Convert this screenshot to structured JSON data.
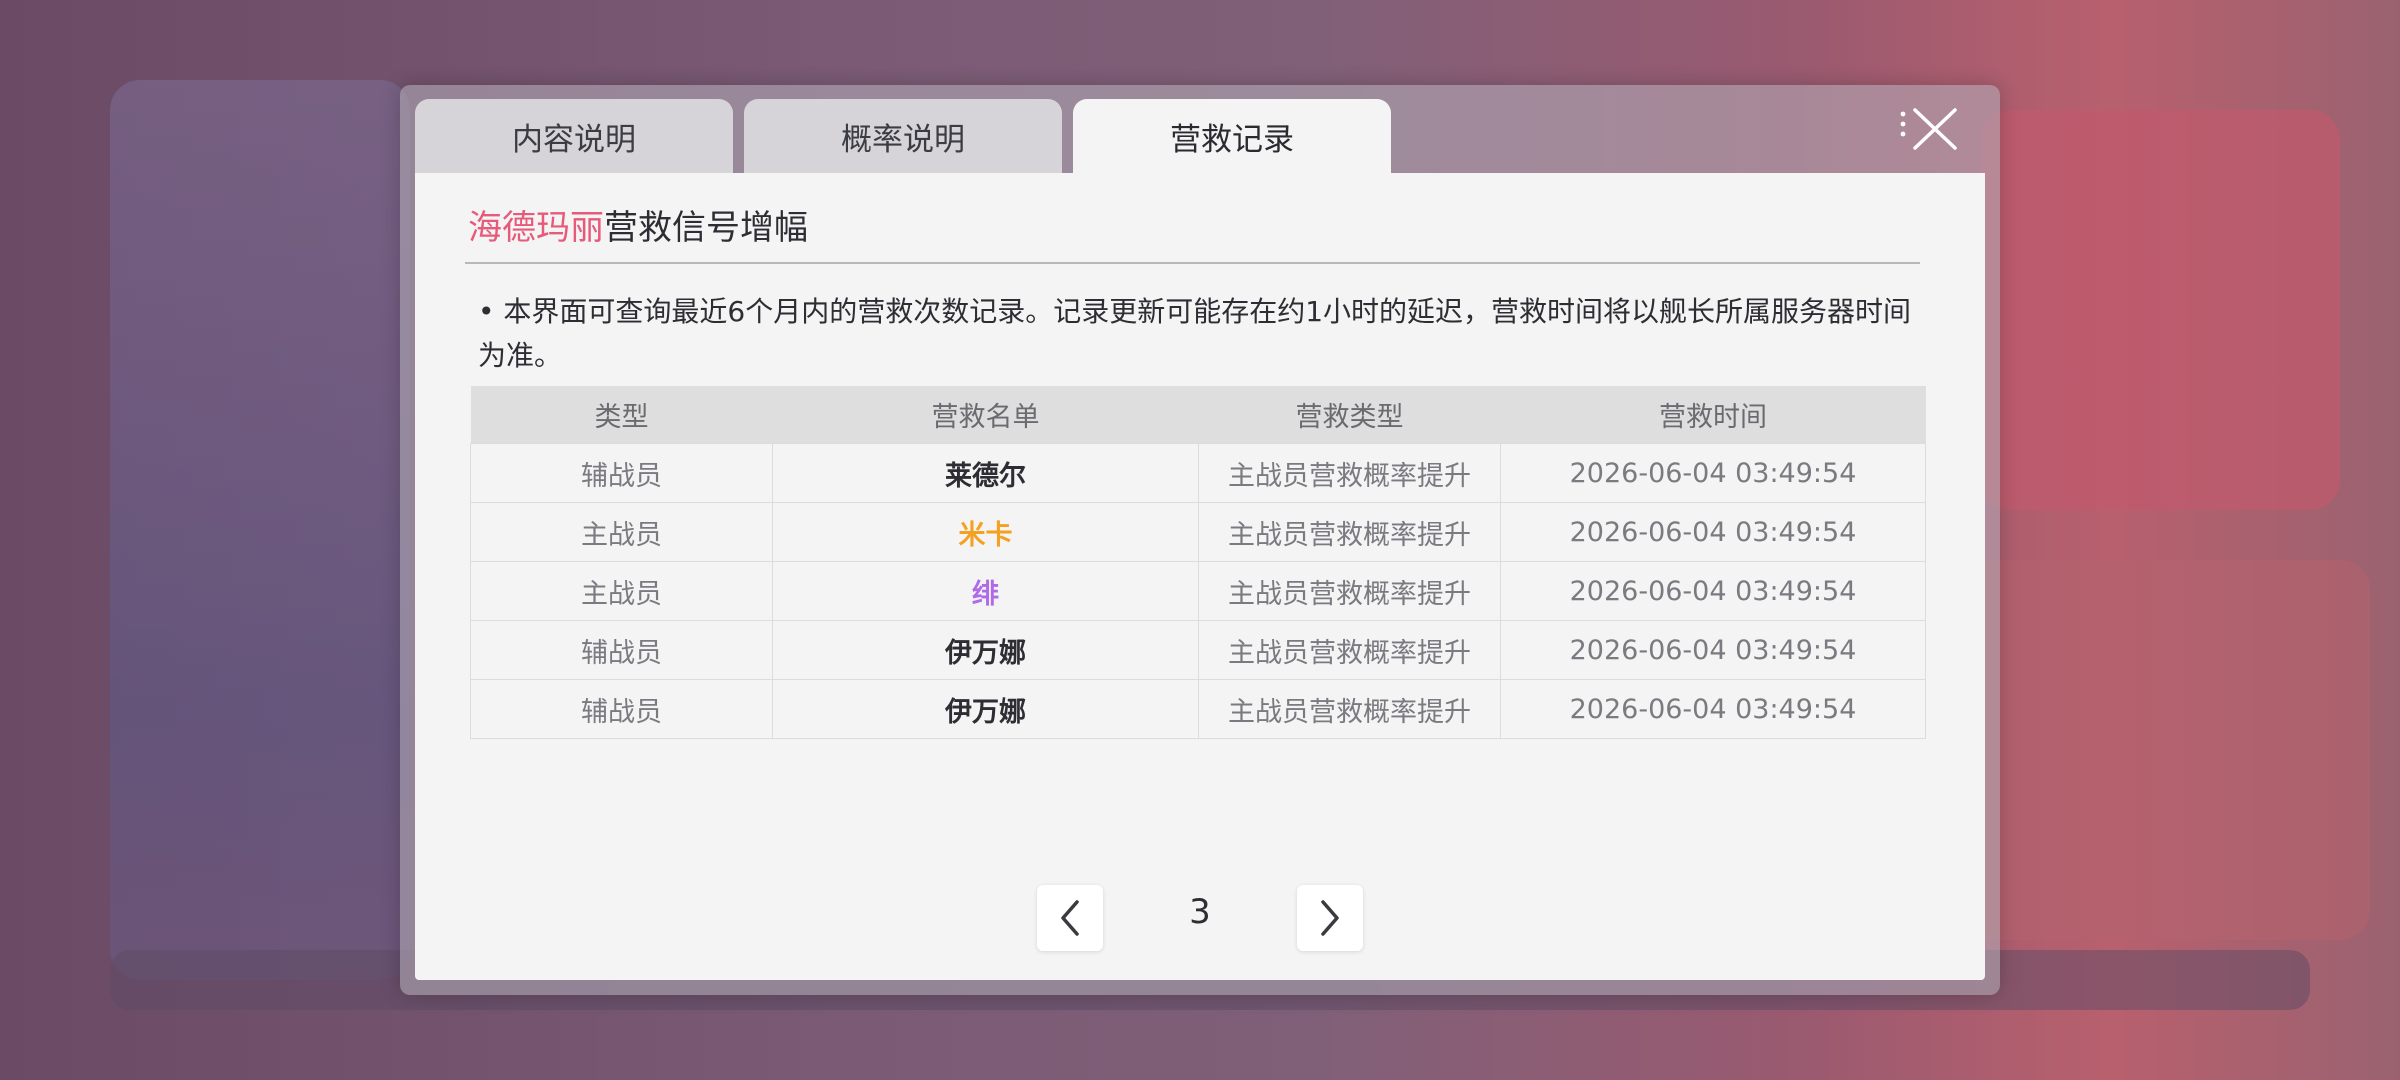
{
  "tabs": [
    {
      "label": "内容说明",
      "active": false
    },
    {
      "label": "概率说明",
      "active": false
    },
    {
      "label": "营救记录",
      "active": true
    }
  ],
  "title": {
    "highlight": "海德玛丽",
    "rest": "营救信号增幅"
  },
  "note": "• 本界面可查询最近6个月内的营救次数记录。记录更新可能存在约1小时的延迟，营救时间将以舰长所属服务器时间为准。",
  "table": {
    "headers": [
      "类型",
      "营救名单",
      "营救类型",
      "营救时间"
    ],
    "rows": [
      {
        "type": "辅战员",
        "name": "莱德尔",
        "rescue_type": "主战员营救概率提升",
        "time": "2026-06-04 03:49:54",
        "name_color": "default"
      },
      {
        "type": "主战员",
        "name": "米卡",
        "rescue_type": "主战员营救概率提升",
        "time": "2026-06-04 03:49:54",
        "name_color": "orange"
      },
      {
        "type": "主战员",
        "name": "绯",
        "rescue_type": "主战员营救概率提升",
        "time": "2026-06-04 03:49:54",
        "name_color": "purple"
      },
      {
        "type": "辅战员",
        "name": "伊万娜",
        "rescue_type": "主战员营救概率提升",
        "time": "2026-06-04 03:49:54",
        "name_color": "default"
      },
      {
        "type": "辅战员",
        "name": "伊万娜",
        "rescue_type": "主战员营救概率提升",
        "time": "2026-06-04 03:49:54",
        "name_color": "default"
      }
    ]
  },
  "pager": {
    "current_page": "3"
  },
  "colors": {
    "highlight": "#e65a7a",
    "orange": "#f4a020",
    "purple": "#b06ae8"
  },
  "icons": {
    "close": "close-icon",
    "prev": "chevron-left-icon",
    "next": "chevron-right-icon"
  }
}
